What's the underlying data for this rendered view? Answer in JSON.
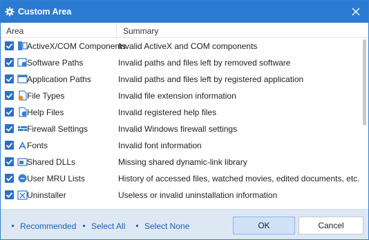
{
  "window": {
    "title": "Custom Area",
    "accent": "#2c7bd3"
  },
  "header": {
    "area": "Area",
    "summary": "Summary"
  },
  "rows": [
    {
      "label": "ActiveX/COM Components",
      "summary": "Invalid ActiveX and COM components",
      "checked": true,
      "icon": "activex-icon"
    },
    {
      "label": "Software Paths",
      "summary": "Invalid paths and files left by removed software",
      "checked": true,
      "icon": "software-paths-icon"
    },
    {
      "label": "Application Paths",
      "summary": "Invalid paths and files left by registered application",
      "checked": true,
      "icon": "application-paths-icon"
    },
    {
      "label": "File Types",
      "summary": "Invalid file extension information",
      "checked": true,
      "icon": "file-types-icon"
    },
    {
      "label": "Help Files",
      "summary": "Invalid registered help files",
      "checked": true,
      "icon": "help-files-icon"
    },
    {
      "label": "Firewall Settings",
      "summary": "Invalid Windows firewall settings",
      "checked": true,
      "icon": "firewall-icon"
    },
    {
      "label": "Fonts",
      "summary": "Invalid font information",
      "checked": true,
      "icon": "fonts-icon"
    },
    {
      "label": "Shared DLLs",
      "summary": "Missing shared dynamic-link library",
      "checked": true,
      "icon": "shared-dlls-icon"
    },
    {
      "label": "User MRU Lists",
      "summary": "History of accessed files, watched movies, edited documents, etc.",
      "checked": true,
      "icon": "mru-icon"
    },
    {
      "label": "Uninstaller",
      "summary": "Useless or invalid uninstallation information",
      "checked": true,
      "icon": "uninstaller-icon"
    }
  ],
  "footer": {
    "recommended": "Recommended",
    "select_all": "Select All",
    "select_none": "Select None",
    "ok": "OK",
    "cancel": "Cancel"
  }
}
